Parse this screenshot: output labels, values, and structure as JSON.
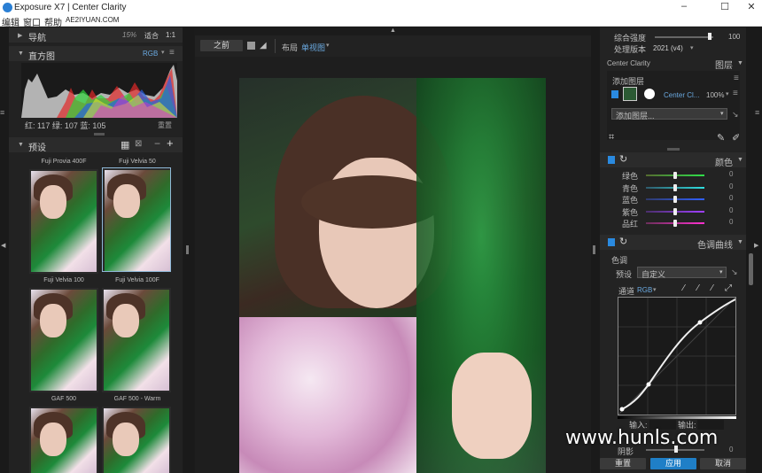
{
  "window": {
    "title": "Exposure X7 | Center Clarity",
    "minimize": "–",
    "maximize": "☐",
    "close": "✕"
  },
  "menu": [
    "编辑",
    "窗口",
    "帮助",
    "AE2IYUAN.COM"
  ],
  "left": {
    "nav": {
      "title": "导航",
      "zoom": "15%",
      "fit": "适合",
      "ratio": "1:1"
    },
    "histogram": {
      "title": "直方图",
      "channel": "RGB",
      "readout": "红: 117 绿: 107 蓝: 105",
      "reset": "重置"
    },
    "presets": {
      "title": "预设",
      "items": [
        {
          "top_label": "Fuji Provia 400F",
          "bottom_label": "Fuji Velvia 100"
        },
        {
          "top_label": "Fuji Velvia 50",
          "bottom_label": "Fuji Velvia 100F"
        },
        {
          "top_label": "",
          "bottom_label": "GAF 500"
        },
        {
          "top_label": "",
          "bottom_label": "GAF 500 - Warm"
        }
      ]
    }
  },
  "center": {
    "before": "之前",
    "layout_label": "布局",
    "layout_value": "单视图"
  },
  "right": {
    "overall": {
      "label": "综合强度",
      "value": "100",
      "version_label": "处理版本",
      "version_value": "2021 (v4)"
    },
    "preset_name": "Center Clarity",
    "layers_label": "图层",
    "add_layer_title": "添加图层",
    "layer_name": "Center Cl...",
    "layer_opacity": "100%",
    "add_layer_select": "添加图层...",
    "color": {
      "title": "颜色",
      "rows": [
        {
          "name": "绿色",
          "value": "0",
          "pos": 0.5
        },
        {
          "name": "青色",
          "value": "0",
          "pos": 0.5
        },
        {
          "name": "蓝色",
          "value": "0",
          "pos": 0.5
        },
        {
          "name": "紫色",
          "value": "0",
          "pos": 0.5
        },
        {
          "name": "品红",
          "value": "0",
          "pos": 0.5
        }
      ]
    },
    "curve": {
      "title": "色调曲线",
      "section": "色调",
      "preset_label": "预设",
      "preset_value": "自定义",
      "channel_label": "通道",
      "channel_value": "RGB",
      "input_label": "输入:",
      "output_label": "输出:",
      "shadow_label": "阴影",
      "shadow_value": "0"
    },
    "buttons": {
      "reset": "重置",
      "apply": "应用",
      "cancel": "取消"
    }
  },
  "watermark": "www.hunls.com",
  "colors": {
    "accent": "#1f7fc7",
    "panel": "#262626",
    "bg": "#1b1b1b"
  }
}
